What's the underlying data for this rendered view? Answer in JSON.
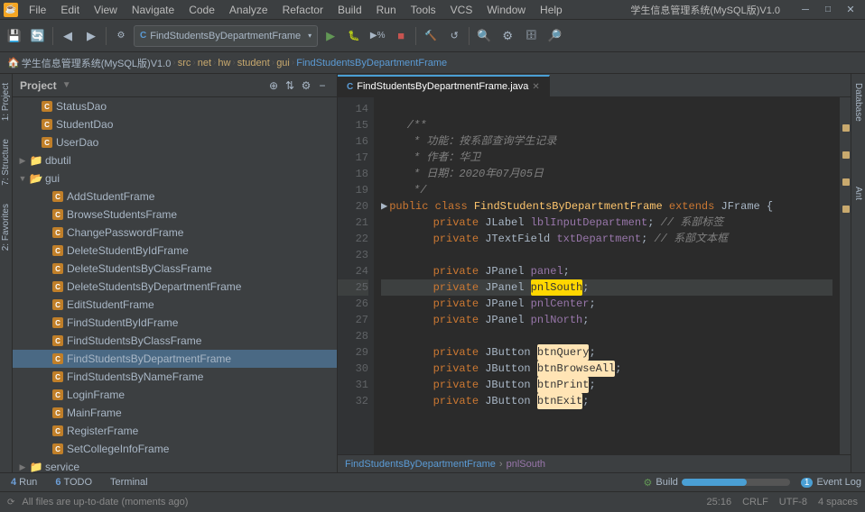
{
  "app": {
    "title": "学生信息管理系统(MySQL版)V1.0",
    "window_controls": [
      "minimize",
      "maximize",
      "close"
    ]
  },
  "menu": {
    "app_icon": "☕",
    "items": [
      "File",
      "Edit",
      "View",
      "Navigate",
      "Code",
      "Analyze",
      "Refactor",
      "Build",
      "Run",
      "Tools",
      "VCS",
      "Window",
      "Help"
    ],
    "right_label": "学生信息管理系统(MySQL版)V1.0"
  },
  "toolbar": {
    "dropdown_label": "FindStudentsByDepartmentFrame",
    "buttons": [
      "save-all",
      "sync",
      "back",
      "forward",
      "run-config",
      "run",
      "debug",
      "run-coverage",
      "stop",
      "build",
      "reload",
      "search",
      "settings",
      "database",
      "search2"
    ]
  },
  "breadcrumb": {
    "items": [
      "学生信息管理系统(MySQL版)V1.0",
      "src",
      "net",
      "hw",
      "student",
      "gui",
      "FindStudentsByDepartmentFrame"
    ]
  },
  "project_panel": {
    "title": "Project",
    "items": [
      {
        "label": "StatusDao",
        "type": "class",
        "depth": 1
      },
      {
        "label": "StudentDao",
        "type": "class",
        "depth": 1
      },
      {
        "label": "UserDao",
        "type": "class",
        "depth": 1
      },
      {
        "label": "dbutil",
        "type": "folder",
        "depth": 0
      },
      {
        "label": "gui",
        "type": "folder",
        "depth": 0,
        "expanded": true
      },
      {
        "label": "AddStudentFrame",
        "type": "class",
        "depth": 2
      },
      {
        "label": "BrowseStudentsFrame",
        "type": "class",
        "depth": 2
      },
      {
        "label": "ChangePasswordFrame",
        "type": "class",
        "depth": 2
      },
      {
        "label": "DeleteStudentByIdFrame",
        "type": "class",
        "depth": 2
      },
      {
        "label": "DeleteStudentsByClassFrame",
        "type": "class",
        "depth": 2
      },
      {
        "label": "DeleteStudentsByDepartmentFrame",
        "type": "class",
        "depth": 2
      },
      {
        "label": "EditStudentFrame",
        "type": "class",
        "depth": 2
      },
      {
        "label": "FindStudentByIdFrame",
        "type": "class",
        "depth": 2
      },
      {
        "label": "FindStudentsByClassFrame",
        "type": "class",
        "depth": 2
      },
      {
        "label": "FindStudentsByDepartmentFrame",
        "type": "class",
        "depth": 2,
        "selected": true
      },
      {
        "label": "FindStudentsByNameFrame",
        "type": "class",
        "depth": 2
      },
      {
        "label": "LoginFrame",
        "type": "class",
        "depth": 2
      },
      {
        "label": "MainFrame",
        "type": "class",
        "depth": 2
      },
      {
        "label": "RegisterFrame",
        "type": "class",
        "depth": 2
      },
      {
        "label": "SetCollegeInfoFrame",
        "type": "class",
        "depth": 2
      },
      {
        "label": "service",
        "type": "folder",
        "depth": 0
      }
    ]
  },
  "editor": {
    "tab_label": "FindStudentsByDepartmentFrame.java",
    "lines": [
      {
        "num": 14,
        "code": "",
        "type": "empty"
      },
      {
        "num": 15,
        "code": "    /**",
        "type": "comment"
      },
      {
        "num": 16,
        "code": "     * 功能：按系部查询学生记录",
        "type": "comment"
      },
      {
        "num": 17,
        "code": "     * 作者：华卫",
        "type": "comment"
      },
      {
        "num": 18,
        "code": "     * 日期：2020年07月05日",
        "type": "comment"
      },
      {
        "num": 19,
        "code": "     */",
        "type": "comment"
      },
      {
        "num": 20,
        "code": "    public class FindStudentsByDepartmentFrame extends JFrame {",
        "type": "code",
        "has_arrow": true
      },
      {
        "num": 21,
        "code": "        private JLabel lblInputDepartment; // 系部标签",
        "type": "code"
      },
      {
        "num": 22,
        "code": "        private JTextField txtDepartment; // 系部文本框",
        "type": "code"
      },
      {
        "num": 23,
        "code": "",
        "type": "empty"
      },
      {
        "num": 24,
        "code": "        private JPanel panel;",
        "type": "code"
      },
      {
        "num": 25,
        "code": "        private JPanel pnlSouth;",
        "type": "code",
        "highlighted": true
      },
      {
        "num": 26,
        "code": "        private JPanel pnlCenter;",
        "type": "code"
      },
      {
        "num": 27,
        "code": "        private JPanel pnlNorth;",
        "type": "code"
      },
      {
        "num": 28,
        "code": "",
        "type": "empty"
      },
      {
        "num": 29,
        "code": "        private JButton btnQuery;",
        "type": "code"
      },
      {
        "num": 30,
        "code": "        private JButton btnBrowseAll;",
        "type": "code"
      },
      {
        "num": 31,
        "code": "        private JButton btnPrint;",
        "type": "code"
      },
      {
        "num": 32,
        "code": "        private JButton btnExit;",
        "type": "code"
      }
    ],
    "breadcrumb_bottom": {
      "class": "FindStudentsByDepartmentFrame",
      "field": "pnlSouth"
    }
  },
  "status_tabs": [
    {
      "num": "4",
      "label": "Run"
    },
    {
      "num": "6",
      "label": "TODO"
    },
    {
      "label": "Terminal"
    }
  ],
  "status_bar": {
    "left": "All files are up-to-date (moments ago)",
    "build_label": "Build",
    "position": "25:16",
    "encoding": "CRLF  UTF-8",
    "indent": "4 spaces",
    "event_log": "Event Log",
    "event_count": "1"
  },
  "right_tabs": {
    "items": [
      "Database",
      "Ant"
    ]
  },
  "left_side_tabs": {
    "items": [
      "1: Project",
      "2: Favorites",
      "7: Structure"
    ]
  }
}
